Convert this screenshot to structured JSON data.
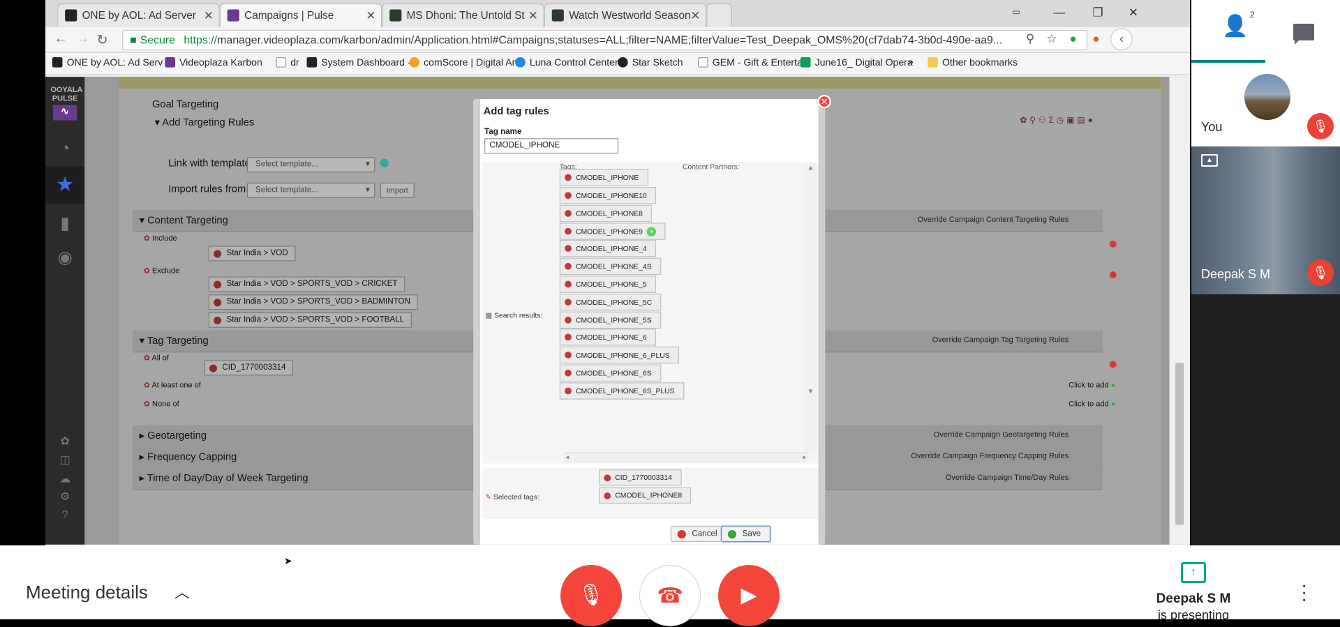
{
  "browser": {
    "tabs": [
      {
        "label": "ONE by AOL: Ad Server",
        "color": "#222"
      },
      {
        "label": "Campaigns | Pulse",
        "color": "#6a3a8c"
      },
      {
        "label": "MS Dhoni: The Untold St",
        "color": "#2c3a2c"
      },
      {
        "label": "Watch Westworld Season",
        "color": "#2c3a2c"
      }
    ],
    "url_protocol": "https://",
    "url_rest": "manager.videoplaza.com/karbon/admin/Application.html#Campaigns;statuses=ALL;filter=NAME;filterValue=Test_Deepak_OMS%20(cf7dab74-3b0d-490e-aa9...",
    "secure_label": "Secure",
    "bookmarks": [
      {
        "label": "ONE by AOL: Ad Serv",
        "color": "#222"
      },
      {
        "label": "Videoplaza Karbon",
        "color": "#6a3a8c"
      },
      {
        "label": "dr",
        "color": "#999"
      },
      {
        "label": "System Dashboard - .",
        "color": "#222"
      },
      {
        "label": "comScore | Digital An",
        "color": "#f4a321"
      },
      {
        "label": "Luna Control Center",
        "color": "#1e88e5"
      },
      {
        "label": "Star Sketch",
        "color": "#222"
      },
      {
        "label": "GEM - Gift & Entertai",
        "color": "#999"
      },
      {
        "label": "June16_ Digital Opera",
        "color": "#0f9d58"
      },
      {
        "label": "Other bookmarks",
        "color": "#f7c948"
      }
    ],
    "more_bookmarks": "»"
  },
  "app": {
    "logo": "OOYALA PULSE",
    "goal_targeting": "Goal Targeting",
    "add_rules": "Add Targeting Rules",
    "link_template_label": "Link with template",
    "import_rules_label": "Import rules from",
    "select_placeholder": "Select template...",
    "import_btn": "Import",
    "content_targeting": "Content Targeting",
    "override_content": "Override Campaign Content Targeting Rules",
    "include": "Include",
    "exclude": "Exclude",
    "include_tags": [
      "Star India > VOD"
    ],
    "exclude_tags": [
      "Star India > VOD > SPORTS_VOD > CRICKET",
      "Star India > VOD > SPORTS_VOD > BADMINTON",
      "Star India > VOD > SPORTS_VOD > FOOTBALL"
    ],
    "tag_targeting": "Tag Targeting",
    "override_tag": "Override Campaign Tag Targeting Rules",
    "all_of": "All of",
    "all_of_tag": "CID_1770003314",
    "at_least": "At least one of",
    "none_of": "None of",
    "click_add": "Click to add",
    "geotargeting": "Geotargeting",
    "override_geo": "Override Campaign Geotargeting Rules",
    "freq_cap": "Frequency Capping",
    "override_freq": "Override Campaign Frequency Capping Rules",
    "time_day": "Time of Day/Day of Week Targeting",
    "override_time": "Override Campaign Time/Day Rules"
  },
  "modal": {
    "title": "Add tag rules",
    "tag_name_label": "Tag name",
    "tag_name_value": "CMODEL_IPHONE",
    "hdr_tags": "Tags:",
    "hdr_partners": "Content Partners:",
    "search_results_label": "Search results:",
    "results": [
      "CMODEL_IPHONE",
      "CMODEL_IPHONE10",
      "CMODEL_IPHONE8",
      "CMODEL_IPHONE9",
      "CMODEL_IPHONE_4",
      "CMODEL_IPHONE_4S",
      "CMODEL_IPHONE_5",
      "CMODEL_IPHONE_5C",
      "CMODEL_IPHONE_5S",
      "CMODEL_IPHONE_6",
      "CMODEL_IPHONE_6_PLUS",
      "CMODEL_IPHONE_6S",
      "CMODEL_IPHONE_6S_PLUS"
    ],
    "selected_label": "Selected tags:",
    "selected": [
      "CID_1770003314",
      "CMODEL_IPHONE8"
    ],
    "cancel": "Cancel",
    "save": "Save"
  },
  "meet": {
    "people_count": "2",
    "you_label": "You",
    "presenter_tile": "Deepak S M",
    "meeting_details": "Meeting details",
    "presenter_name": "Deepak S M",
    "presenting_text": "is presenting"
  },
  "colors": {
    "accent": "#00897b",
    "red": "#ea4335",
    "mic_red": "#f4453b"
  }
}
